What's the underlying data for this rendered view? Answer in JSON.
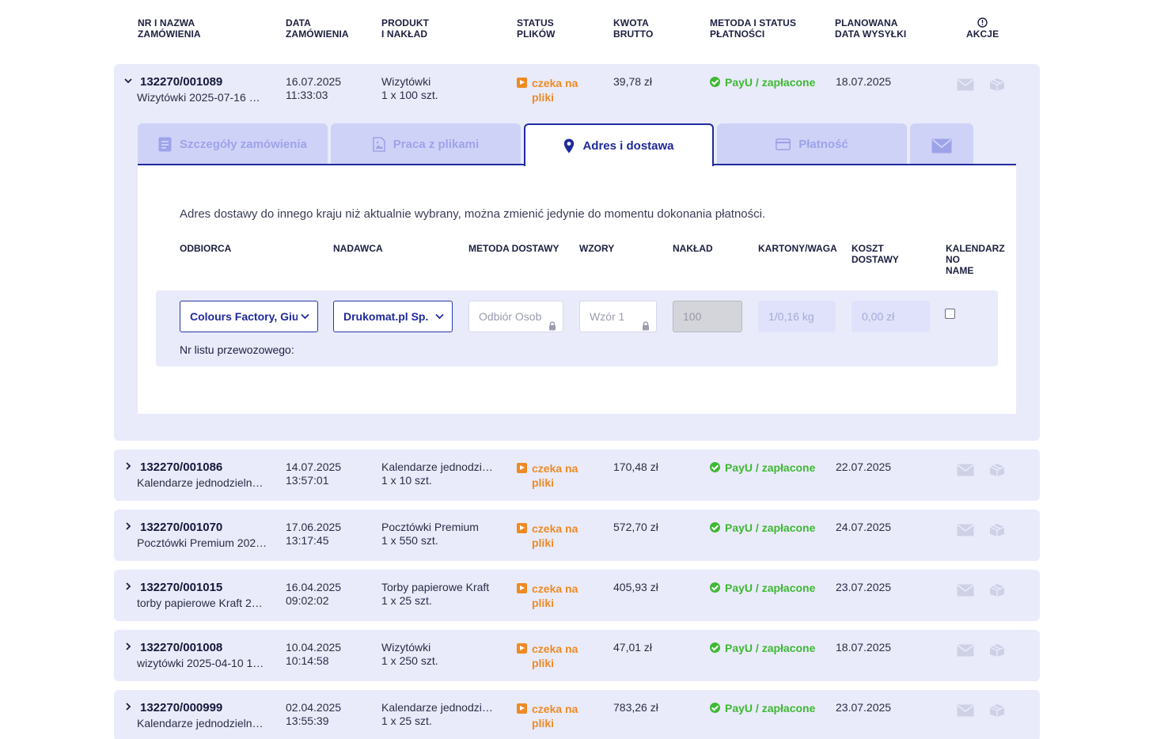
{
  "headers": {
    "order": [
      "NR I NAZWA",
      "ZAMÓWIENIA"
    ],
    "date": [
      "DATA",
      "ZAMÓWIENIA"
    ],
    "product": [
      "PRODUKT",
      "I NAKŁAD"
    ],
    "files": [
      "STATUS",
      "PLIKÓW"
    ],
    "amount": [
      "KWOTA",
      "BRUTTO"
    ],
    "payment": [
      "METODA I STATUS",
      "PŁATNOŚCI"
    ],
    "shipping": [
      "PLANOWANA",
      "DATA WYSYŁKI"
    ],
    "actions": "AKCJE"
  },
  "expanded_order": {
    "number": "132270/001089",
    "name": "Wizytówki 2025-07-16 …",
    "date": "16.07.2025",
    "time": "11:33:03",
    "product": "Wizytówki",
    "quantity": "1 x 100 szt.",
    "file_status": "czeka na pliki",
    "amount": "39,78 zł",
    "payment": "PayU / zapłacone",
    "ship_date": "18.07.2025"
  },
  "tabs": [
    {
      "label": "Szczegóły zamówienia",
      "icon": "document-icon"
    },
    {
      "label": "Praca z plikami",
      "icon": "image-file-icon"
    },
    {
      "label": "Adres i dostawa",
      "icon": "location-pin-icon",
      "active": true
    },
    {
      "label": "Płatność",
      "icon": "credit-card-icon"
    },
    {
      "label": "",
      "icon": "envelope-icon"
    }
  ],
  "delivery": {
    "info": "Adres dostawy do innego kraju niż aktualnie wybrany, można zmienić jedynie do momentu dokonania płatności.",
    "columns": {
      "recipient": "ODBIORCA",
      "sender": "NADAWCA",
      "method": "METODA DOSTAWY",
      "designs": "WZORY",
      "quantity": "NAKŁAD",
      "boxes": "KARTONY/WAGA",
      "cost": [
        "KOSZT",
        "DOSTAWY"
      ],
      "calendar": [
        "KALENDARZ",
        "NO",
        "NAME"
      ]
    },
    "recipient_value": "Colours Factory, Gius",
    "sender_value": "Drukomat.pl Sp. z",
    "method_value": "Odbiór Osob",
    "design_value": "Wzór 1",
    "quantity_value": "100",
    "boxes_value": "1/0,16 kg",
    "cost_value": "0,00 zł",
    "tracking_label": "Nr listu przewozowego:"
  },
  "orders": [
    {
      "number": "132270/001086",
      "name": "Kalendarze jednodzieln…",
      "date": "14.07.2025",
      "time": "13:57:01",
      "product": "Kalendarze jednodzi…",
      "quantity": "1 x 10 szt.",
      "file_status": "czeka na pliki",
      "amount": "170,48 zł",
      "payment": "PayU / zapłacone",
      "ship_date": "22.07.2025"
    },
    {
      "number": "132270/001070",
      "name": "Pocztówki Premium 202…",
      "date": "17.06.2025",
      "time": "13:17:45",
      "product": "Pocztówki Premium",
      "quantity": "1 x 550 szt.",
      "file_status": "czeka na pliki",
      "amount": "572,70 zł",
      "payment": "PayU / zapłacone",
      "ship_date": "24.07.2025"
    },
    {
      "number": "132270/001015",
      "name": "torby papierowe Kraft 2…",
      "date": "16.04.2025",
      "time": "09:02:02",
      "product": "Torby papierowe Kraft",
      "quantity": "1 x 25 szt.",
      "file_status": "czeka na pliki",
      "amount": "405,93 zł",
      "payment": "PayU / zapłacone",
      "ship_date": "23.07.2025"
    },
    {
      "number": "132270/001008",
      "name": "wizytówki 2025-04-10 1…",
      "date": "10.04.2025",
      "time": "10:14:58",
      "product": "Wizytówki",
      "quantity": "1 x 250 szt.",
      "file_status": "czeka na pliki",
      "amount": "47,01 zł",
      "payment": "PayU / zapłacone",
      "ship_date": "18.07.2025"
    },
    {
      "number": "132270/000999",
      "name": "Kalendarze jednodzieln…",
      "date": "02.04.2025",
      "time": "13:55:39",
      "product": "Kalendarze jednodzi…",
      "quantity": "1 x 25 szt.",
      "file_status": "czeka na pliki",
      "amount": "783,26 zł",
      "payment": "PayU / zapłacone",
      "ship_date": "23.07.2025"
    }
  ],
  "colors": {
    "accent": "#202aa0",
    "row_bg": "#e9ebfb",
    "status_orange": "#ef8a22",
    "paid_green": "#3fb833"
  }
}
